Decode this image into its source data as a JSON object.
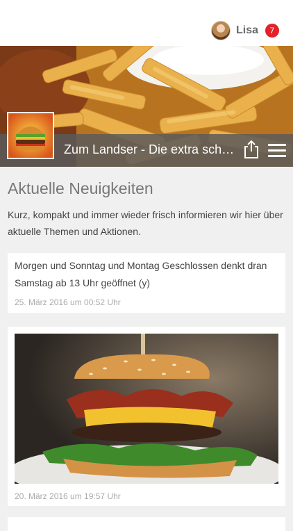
{
  "user": {
    "name": "Lisa",
    "notifications": "7"
  },
  "header": {
    "title": "Zum Landser - Die extra scharfe Currywurst"
  },
  "main": {
    "heading": "Aktuelle Neuigkeiten",
    "intro": "Kurz, kompakt und immer wieder frisch informieren wir hier über aktuelle Themen und Aktionen.",
    "posts": [
      {
        "text": "Morgen und Sonntag und Montag Geschlossen denkt dran Samstag ab 13 Uhr geöffnet (y)",
        "date": "25. März 2016 um 00:52 Uhr"
      },
      {
        "text": "",
        "date": "20. März 2016 um 19:57 Uhr"
      }
    ]
  },
  "colors": {
    "badge": "#e4202a",
    "titlebar": "#5a5a5a",
    "background": "#f0f0f0"
  },
  "icons": {
    "share": "share-icon",
    "menu": "menu-icon"
  }
}
